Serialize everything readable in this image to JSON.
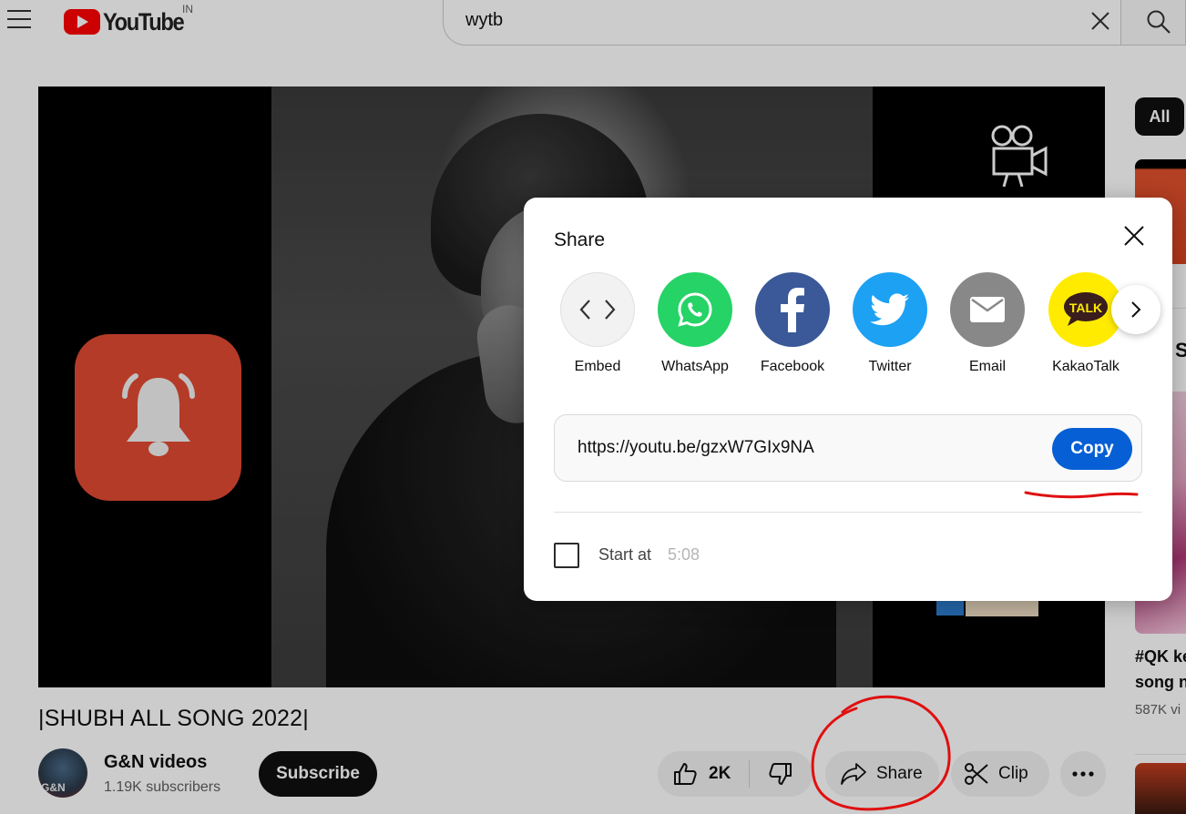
{
  "header": {
    "logo_text": "YouTube",
    "country_code": "IN",
    "search_value": "wytb"
  },
  "player": {
    "camera_icon": "video-camera-icon",
    "bell_icon": "notification-bell-icon"
  },
  "video": {
    "title": "|SHUBH ALL SONG 2022|",
    "channel_name": "G&N videos",
    "avatar_text": "G&N",
    "subscribers": "1.19K subscribers",
    "subscribe_label": "Subscribe",
    "like_count": "2K",
    "share_label": "Share",
    "clip_label": "Clip"
  },
  "sidebar": {
    "chip_all": "All",
    "partial_letter": "S",
    "item_title_line1": "#QK ke",
    "item_title_line2": "song n",
    "item_views": "587K vi"
  },
  "share_dialog": {
    "title": "Share",
    "targets": [
      {
        "label": "Embed",
        "color": "#f2f2f2",
        "icon": "embed-code-icon"
      },
      {
        "label": "WhatsApp",
        "color": "#25d366",
        "icon": "whatsapp-icon"
      },
      {
        "label": "Facebook",
        "color": "#3b5998",
        "icon": "facebook-icon"
      },
      {
        "label": "Twitter",
        "color": "#1da1f2",
        "icon": "twitter-bird-icon"
      },
      {
        "label": "Email",
        "color": "#888888",
        "icon": "email-envelope-icon"
      },
      {
        "label": "KakaoTalk",
        "color": "#ffeb00",
        "icon": "kakaotalk-icon",
        "badge": "TALK"
      }
    ],
    "url": "https://youtu.be/gzxW7GIx9NA",
    "copy_label": "Copy",
    "start_at_label": "Start at",
    "start_at_time": "5:08"
  },
  "colors": {
    "youtube_red": "#ff0000",
    "copy_blue": "#065fd4",
    "annotation_red": "#e01010"
  }
}
